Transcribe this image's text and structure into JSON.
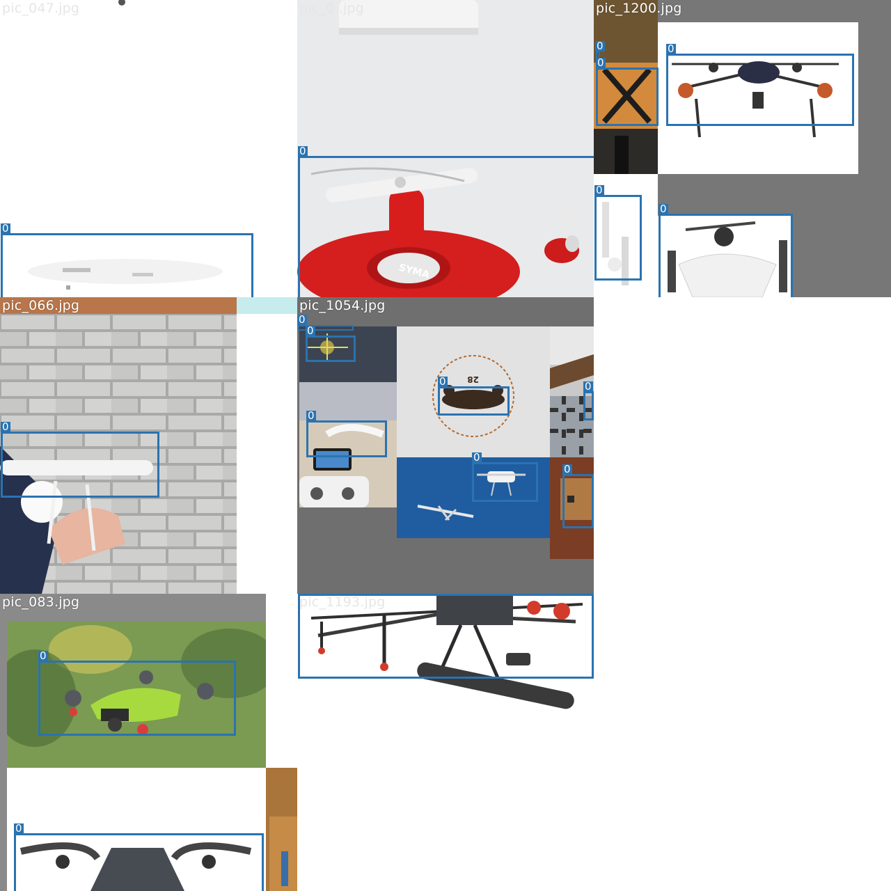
{
  "grid": {
    "tiles": [
      {
        "filename": "pic_047.jpg"
      },
      {
        "filename": "pic_0  .jpg"
      },
      {
        "filename": "pic_1200.jpg"
      },
      {
        "filename": "pic_066.jpg"
      },
      {
        "filename": "pic_1054.jpg"
      },
      {
        "filename": "pic_083.jpg"
      },
      {
        "filename": "pic_1193.jpg"
      }
    ]
  },
  "detection": {
    "class_label": "0",
    "box_color": "#2a73b0"
  },
  "logo_text": {
    "ring": "CUSTOM DRONE SOLUTIONS",
    "ring_bottom": "WE'LL GET YOU OFF THE GROUND",
    "number": "28",
    "brand_syma": "SYMA"
  }
}
